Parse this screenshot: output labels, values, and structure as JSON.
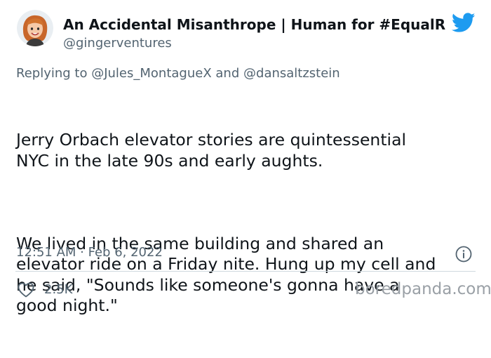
{
  "tweet": {
    "display_name": "An Accidental Misanthrope | Human for #EqualRi…",
    "handle": "@gingerventures",
    "replying_prefix": "Replying to",
    "replying_mention_1": "@Jules_MontagueX",
    "replying_and": "and",
    "replying_mention_2": "@dansaltzstein",
    "text_paragraphs": [
      "Jerry Orbach elevator stories are quintessential\nNYC in the late 90s and early aughts.",
      "We lived in the same building and shared an\nelevator ride on a Friday nite. Hung up my cell and\nhe said, \"Sounds like someone's gonna have a\ngood night.\""
    ],
    "timestamp": "12:51 AM · Feb 6, 2022",
    "like_count": "2.5K"
  },
  "icons": {
    "brand": "twitter-bird-icon",
    "info": "info-icon",
    "like": "heart-icon"
  },
  "watermark": "boredpanda.com",
  "colors": {
    "twitter_blue": "#1d9bf0",
    "secondary_text": "#536471",
    "primary_text": "#0f1419"
  }
}
